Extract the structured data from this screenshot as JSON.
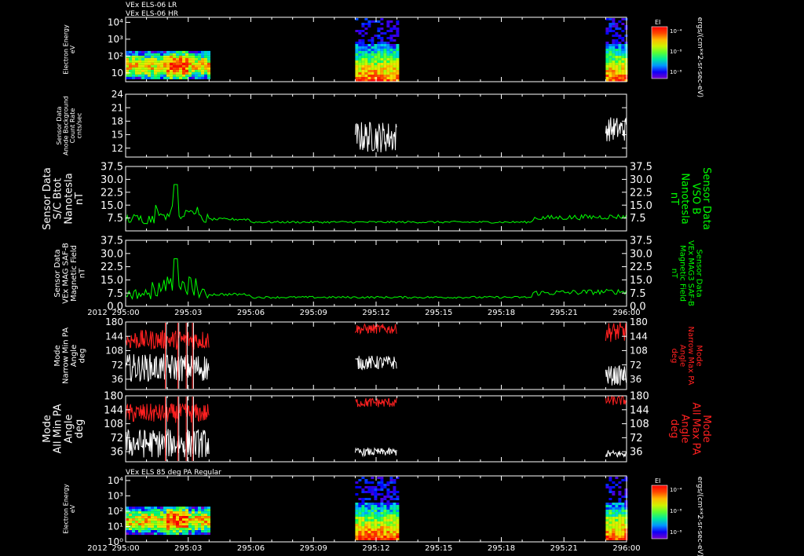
{
  "chart_data": [
    {
      "type": "heatmap",
      "title_lines": [
        "VEx ELS-06 LR",
        "VEx ELS-06 HR"
      ],
      "ylabel_lines": [
        "Electron Energy",
        "eV"
      ],
      "ylim": [
        3,
        20000
      ],
      "y_scale": "log",
      "y_ticks": [
        10,
        100,
        1000,
        10000
      ],
      "y_tick_labels": [
        "10",
        "10²",
        "10³",
        "10⁴"
      ],
      "colorbar": {
        "label": "EI",
        "ticks": [
          "10⁻⁴",
          "10⁻⁸",
          "10⁻⁸"
        ]
      },
      "colorbar_title": "ergs/(cm**2-sr-sec-eV)",
      "blocks": [
        {
          "x0": "295:00",
          "x1": "295:04",
          "ymin": 5,
          "ymax": 200
        },
        {
          "x0": "295:11",
          "x1": "295:13",
          "ymin": 3,
          "ymax": 20000
        },
        {
          "x0": "295:23",
          "x1": "295:24",
          "ymin": 3,
          "ymax": 20000
        }
      ]
    },
    {
      "type": "line",
      "ylabel_lines": [
        "Sensor Data",
        "Anode Background",
        "Count Rate",
        "cnts/sec"
      ],
      "ylim": [
        10,
        24
      ],
      "y_ticks": [
        12,
        15,
        18,
        21,
        24
      ],
      "series": [
        {
          "color": "#ffffff",
          "segments": [
            {
              "x0": "295:11",
              "x1": "295:13",
              "low": 11,
              "high": 18
            },
            {
              "x0": "295:23",
              "x1": "295:24",
              "low": 13.5,
              "high": 19
            }
          ]
        }
      ]
    },
    {
      "type": "line",
      "ylabel_lines": [
        "Sensor Data",
        "S/C Btot",
        "Nanotesla",
        "nT"
      ],
      "ylabel_right_lines": [
        "Sensor Data",
        "VSO B",
        "Nanotesla",
        "nT"
      ],
      "ylim": [
        0,
        37.5
      ],
      "y_ticks": [
        7.5,
        15.0,
        22.5,
        30.0,
        37.5
      ],
      "y_tick_labels": [
        "7.5",
        "15.0",
        "22.5",
        "30.0",
        "37.5"
      ],
      "series": [
        {
          "color": "#00ff00"
        }
      ]
    },
    {
      "type": "line",
      "ylabel_lines": [
        "Sensor Data",
        "VEx MAG SAF-B",
        "Magnetic Field",
        "nT"
      ],
      "ylabel_right_lines": [
        "Sensor Data",
        "VEx MAG3 SAF-B",
        "Magnetic Field",
        "nT"
      ],
      "ylim": [
        0,
        37.5
      ],
      "y_ticks": [
        0,
        7.5,
        15.0,
        22.5,
        30.0,
        37.5
      ],
      "y_tick_labels": [
        "0.0",
        "7.5",
        "15.0",
        "22.5",
        "30.0",
        "37.5"
      ],
      "series": [
        {
          "color": "#00ff00"
        }
      ],
      "x_tick_labels": [
        "295:00",
        "295:03",
        "295:06",
        "295:09",
        "295:12",
        "295:15",
        "295:18",
        "295:21",
        "296:00"
      ],
      "x_year": "2012"
    },
    {
      "type": "line",
      "ylabel_lines": [
        "Mode",
        "Narrow Min PA",
        "Angle",
        "deg"
      ],
      "ylabel_right_lines": [
        "Mode",
        "Narrow Max PA",
        "Angle",
        "deg"
      ],
      "ylim": [
        10,
        180
      ],
      "y_ticks": [
        36,
        72,
        108,
        144,
        180
      ],
      "series": [
        {
          "color": "#ff2020",
          "segments": [
            {
              "x0": "295:00",
              "x1": "295:04",
              "low": 110,
              "high": 160
            },
            {
              "x0": "295:11",
              "x1": "295:13",
              "low": 150,
              "high": 175
            },
            {
              "x0": "295:23",
              "x1": "295:24",
              "low": 130,
              "high": 180
            }
          ]
        },
        {
          "color": "#ffffff",
          "segments": [
            {
              "x0": "295:00",
              "x1": "295:04",
              "low": 30,
              "high": 100
            },
            {
              "x0": "295:11",
              "x1": "295:13",
              "low": 60,
              "high": 95
            },
            {
              "x0": "295:23",
              "x1": "295:24",
              "low": 20,
              "high": 70
            }
          ]
        }
      ]
    },
    {
      "type": "line",
      "ylabel_lines": [
        "Mode",
        "All Min PA",
        "Angle",
        "deg"
      ],
      "ylabel_right_lines": [
        "Mode",
        "All Max PA",
        "Angle",
        "deg"
      ],
      "ylim": [
        10,
        180
      ],
      "y_ticks": [
        36,
        72,
        108,
        144,
        180
      ],
      "series": [
        {
          "color": "#ff2020",
          "segments": [
            {
              "x0": "295:00",
              "x1": "295:04",
              "low": 110,
              "high": 160
            },
            {
              "x0": "295:11",
              "x1": "295:13",
              "low": 150,
              "high": 175
            },
            {
              "x0": "295:23",
              "x1": "295:24",
              "low": 155,
              "high": 180
            }
          ]
        },
        {
          "color": "#ffffff",
          "segments": [
            {
              "x0": "295:00",
              "x1": "295:04",
              "low": 20,
              "high": 95
            },
            {
              "x0": "295:11",
              "x1": "295:13",
              "low": 25,
              "high": 45
            },
            {
              "x0": "295:23",
              "x1": "295:24",
              "low": 20,
              "high": 40
            }
          ]
        }
      ]
    },
    {
      "type": "heatmap",
      "title_lines": [
        "VEx ELS 85 deg PA Regular"
      ],
      "ylabel_lines": [
        "Electron Energy",
        "eV"
      ],
      "ylim": [
        1,
        20000
      ],
      "y_scale": "log",
      "y_ticks": [
        1,
        10,
        100,
        1000,
        10000
      ],
      "y_tick_labels": [
        "10⁰",
        "10¹",
        "10²",
        "10³",
        "10⁴"
      ],
      "colorbar": {
        "label": "EI",
        "ticks": [
          "10⁻⁴",
          "10⁻⁸",
          "10⁻⁸"
        ]
      },
      "colorbar_title": "ergs/(cm**2-sr-sec-eV)",
      "blocks": [
        {
          "x0": "295:00",
          "x1": "295:04",
          "ymin": 4,
          "ymax": 200
        },
        {
          "x0": "295:11",
          "x1": "295:13",
          "ymin": 1.5,
          "ymax": 20000
        },
        {
          "x0": "295:23",
          "x1": "295:24",
          "ymin": 1.5,
          "ymax": 20000
        }
      ],
      "x_tick_labels": [
        "295:00",
        "295:03",
        "295:06",
        "295:09",
        "295:12",
        "295:15",
        "295:18",
        "295:21",
        "296:00"
      ],
      "x_year": "2012"
    }
  ]
}
